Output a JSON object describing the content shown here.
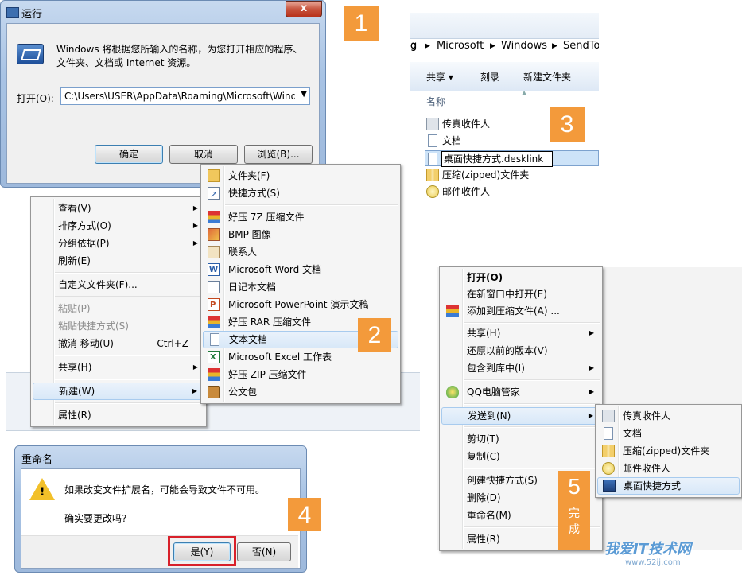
{
  "badges": {
    "b1": "1",
    "b2": "2",
    "b3": "3",
    "b4": "4",
    "b5": "5",
    "b5_text": "完成"
  },
  "run_dialog": {
    "title": "运行",
    "description": "Windows 将根据您所输入的名称，为您打开相应的程序、文件夹、文档或 Internet 资源。",
    "open_label": "打开(O):",
    "open_value": "C:\\Users\\USER\\AppData\\Roaming\\Microsoft\\Windows",
    "ok": "确定",
    "cancel": "取消",
    "browse": "浏览(B)...",
    "close": "x"
  },
  "context_menu": {
    "items": [
      {
        "label": "查看(V)",
        "arrow": true
      },
      {
        "label": "排序方式(O)",
        "arrow": true
      },
      {
        "label": "分组依据(P)",
        "arrow": true
      },
      {
        "label": "刷新(E)"
      },
      {
        "label": "自定义文件夹(F)..."
      },
      {
        "label": "粘贴(P)",
        "disabled": true
      },
      {
        "label": "粘贴快捷方式(S)",
        "disabled": true
      },
      {
        "label": "撤消 移动(U)",
        "accel": "Ctrl+Z"
      },
      {
        "label": "共享(H)",
        "arrow": true
      },
      {
        "label": "新建(W)",
        "arrow": true
      },
      {
        "label": "属性(R)"
      }
    ]
  },
  "new_submenu": {
    "items": [
      {
        "label": "文件夹(F)",
        "icon": "folder-icon"
      },
      {
        "label": "快捷方式(S)",
        "icon": "shortcut-icon"
      },
      {
        "label": "好压 7Z 压缩文件",
        "icon": "archive-icon"
      },
      {
        "label": "BMP 图像",
        "icon": "bmp-image-icon"
      },
      {
        "label": "联系人",
        "icon": "contact-icon"
      },
      {
        "label": "Microsoft Word 文档",
        "icon": "word-doc-icon"
      },
      {
        "label": "日记本文档",
        "icon": "journal-icon"
      },
      {
        "label": "Microsoft PowerPoint 演示文稿",
        "icon": "powerpoint-icon"
      },
      {
        "label": "好压 RAR 压缩文件",
        "icon": "archive-icon"
      },
      {
        "label": "文本文档",
        "icon": "text-doc-icon"
      },
      {
        "label": "Microsoft Excel 工作表",
        "icon": "excel-icon"
      },
      {
        "label": "好压 ZIP 压缩文件",
        "icon": "archive-icon"
      },
      {
        "label": "公文包",
        "icon": "briefcase-icon"
      }
    ]
  },
  "explorer": {
    "breadcrumb": [
      "g",
      "Microsoft",
      "Windows",
      "SendTo"
    ],
    "toolbar": {
      "share": "共享 ▾",
      "burn": "刻录",
      "new_folder": "新建文件夹"
    },
    "column_name": "名称",
    "items": [
      {
        "label": "传真收件人",
        "icon": "fax-icon"
      },
      {
        "label": "文档",
        "icon": "document-icon"
      },
      {
        "label": "桌面快捷方式.desklink",
        "icon": "text-doc-icon",
        "editing": true
      },
      {
        "label": "压缩(zipped)文件夹",
        "icon": "zip-folder-icon"
      },
      {
        "label": "邮件收件人",
        "icon": "mail-icon"
      }
    ]
  },
  "rename_dialog": {
    "title": "重命名",
    "message": "如果改变文件扩展名，可能会导致文件不可用。",
    "question": "确实要更改吗?",
    "yes": "是(Y)",
    "no": "否(N)"
  },
  "file_menu": {
    "items": [
      {
        "label": "打开(O)",
        "bold": true
      },
      {
        "label": "在新窗口中打开(E)"
      },
      {
        "label": "添加到压缩文件(A) ...",
        "icon": "archive-icon"
      },
      {
        "label": "共享(H)",
        "arrow": true
      },
      {
        "label": "还原以前的版本(V)"
      },
      {
        "label": "包含到库中(I)",
        "arrow": true
      },
      {
        "label": "QQ电脑管家",
        "arrow": true,
        "icon": "qq-shield-icon"
      },
      {
        "label": "发送到(N)",
        "arrow": true
      },
      {
        "label": "剪切(T)"
      },
      {
        "label": "复制(C)"
      },
      {
        "label": "创建快捷方式(S)"
      },
      {
        "label": "删除(D)"
      },
      {
        "label": "重命名(M)"
      },
      {
        "label": "属性(R)"
      }
    ]
  },
  "sendto_submenu": {
    "items": [
      {
        "label": "传真收件人",
        "icon": "fax-icon"
      },
      {
        "label": "文档",
        "icon": "document-icon"
      },
      {
        "label": "压缩(zipped)文件夹",
        "icon": "zip-folder-icon"
      },
      {
        "label": "邮件收件人",
        "icon": "mail-icon"
      },
      {
        "label": "桌面快捷方式",
        "icon": "desktop-icon"
      }
    ]
  },
  "watermark": {
    "text": "我爱IT技术网",
    "url": "www.52ij.com"
  }
}
